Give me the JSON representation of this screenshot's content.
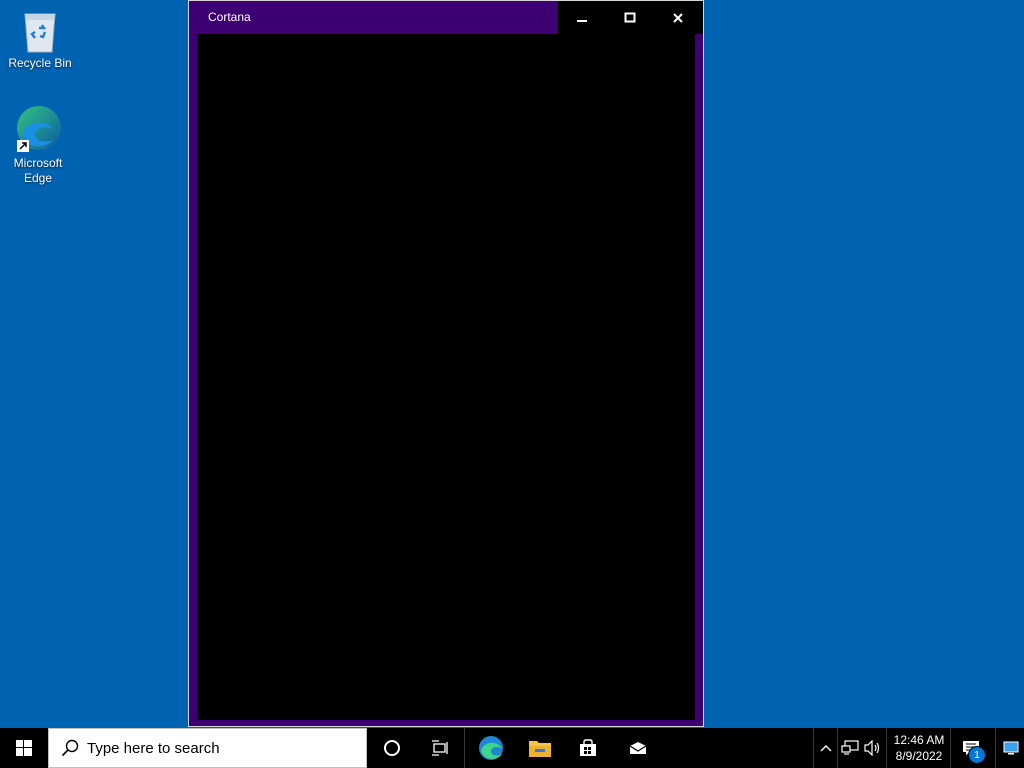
{
  "desktop": {
    "background": "#0063b1",
    "icons": [
      {
        "label": "Recycle Bin",
        "icon": "recycle-bin-icon"
      },
      {
        "label": "Microsoft Edge",
        "icon": "edge-icon"
      }
    ]
  },
  "cortana_window": {
    "title": "Cortana",
    "accent": "#3c0073",
    "controls": [
      "minimize-icon",
      "maximize-icon",
      "close-icon"
    ]
  },
  "taskbar": {
    "search_placeholder": "Type here to search",
    "pinned": [
      "cortana-icon",
      "task-view-icon",
      "edge-icon",
      "file-explorer-icon",
      "store-icon",
      "mail-icon"
    ],
    "tray": {
      "time": "12:46 AM",
      "date": "8/9/2022",
      "notification_count": "1"
    }
  }
}
